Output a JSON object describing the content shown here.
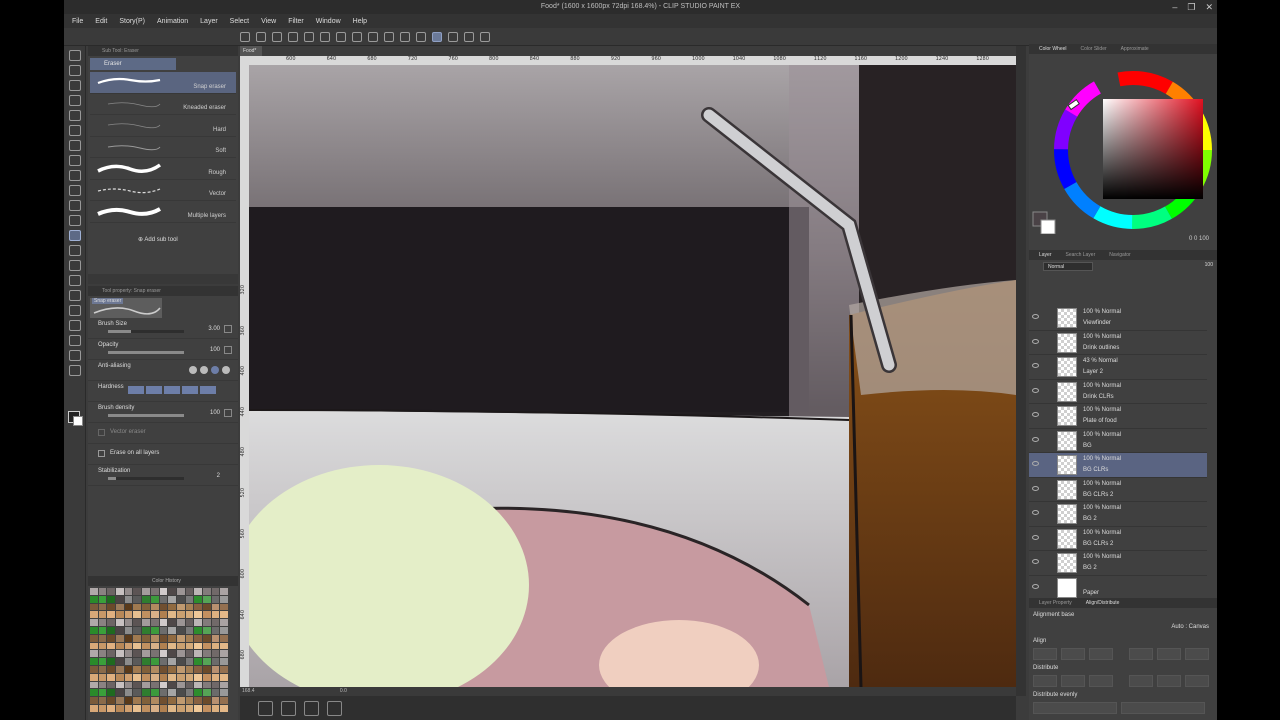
{
  "window": {
    "title": "Food* (1600 x 1600px 72dpi 168.4%)  - CLIP STUDIO PAINT EX",
    "controls": [
      "–",
      "❐",
      "✕"
    ]
  },
  "menu": [
    "File",
    "Edit",
    "Story(P)",
    "Animation",
    "Layer",
    "Select",
    "View",
    "Filter",
    "Window",
    "Help"
  ],
  "sub_tool_panel": {
    "header": "Sub Tool: Eraser",
    "group": "Eraser",
    "brushes": [
      {
        "name": "Snap eraser",
        "selected": true
      },
      {
        "name": "Kneaded eraser",
        "selected": false
      },
      {
        "name": "Hard",
        "selected": false
      },
      {
        "name": "Soft",
        "selected": false
      },
      {
        "name": "Rough",
        "selected": false
      },
      {
        "name": "Vector",
        "selected": false
      },
      {
        "name": "Multiple layers",
        "selected": false
      }
    ],
    "add_label": "Add sub tool"
  },
  "tool_property": {
    "header": "Tool property: Snap eraser",
    "preview_label": "Snap eraser",
    "brush_size": {
      "label": "Brush Size",
      "value": "3.00",
      "fraction": 0.3
    },
    "opacity": {
      "label": "Opacity",
      "value": "100",
      "fraction": 1.0
    },
    "anti_aliasing": {
      "label": "Anti-aliasing"
    },
    "hardness": {
      "label": "Hardness"
    },
    "brush_density": {
      "label": "Brush density",
      "value": "100",
      "fraction": 1.0
    },
    "vector_eraser": {
      "label": "Vector eraser"
    },
    "erase_all_layers": {
      "label": "Erase on all layers"
    },
    "stabilization": {
      "label": "Stabilization",
      "value": "2",
      "fraction": 0.1
    }
  },
  "color_history": {
    "header": "Color History"
  },
  "canvas": {
    "tab": "Food*",
    "zoom": "168.4",
    "angle": "0.0",
    "ruler_top": [
      "600",
      "640",
      "680",
      "720",
      "760",
      "800",
      "840",
      "880",
      "920",
      "960",
      "1000",
      "1040",
      "1080",
      "1120",
      "1160",
      "1200",
      "1240",
      "1280"
    ],
    "ruler_left": [
      "320",
      "360",
      "400",
      "440",
      "480",
      "520",
      "560",
      "600",
      "640",
      "680"
    ]
  },
  "right_panels": {
    "color_tabs": [
      "Color Wheel",
      "Color Slider",
      "Approximate"
    ],
    "color_values": "0  0  100",
    "layer_tabs": [
      "Layer",
      "Search Layer",
      "Navigator"
    ],
    "blend_mode": "Normal",
    "opacity": "100",
    "layers": [
      {
        "mode": "100 % Normal",
        "name": "Viewfinder",
        "type": "mask"
      },
      {
        "mode": "100 % Normal",
        "name": "Drink outlines",
        "type": "trans"
      },
      {
        "mode": "43 % Normal",
        "name": "Layer 2",
        "type": "trans"
      },
      {
        "mode": "100 % Normal",
        "name": "Drink CLRs",
        "type": "trans"
      },
      {
        "mode": "100 % Normal",
        "name": "Plate of food",
        "type": "folder"
      },
      {
        "mode": "100 % Normal",
        "name": "BG",
        "type": "trans"
      },
      {
        "mode": "100 % Normal",
        "name": "BG CLRs",
        "type": "trans",
        "selected": true
      },
      {
        "mode": "100 % Normal",
        "name": "BG CLRs 2",
        "type": "trans"
      },
      {
        "mode": "100 % Normal",
        "name": "BG 2",
        "type": "trans"
      },
      {
        "mode": "100 % Normal",
        "name": "BG CLRs 2",
        "type": "trans"
      },
      {
        "mode": "100 % Normal",
        "name": "BG 2",
        "type": "trans"
      },
      {
        "mode": "",
        "name": "Paper",
        "type": "white"
      }
    ],
    "align_tabs": [
      "Layer Property",
      "Align/Distribute"
    ],
    "alignment_base": "Alignment base",
    "auto_canvas": "Auto : Canvas",
    "align": "Align",
    "distribute": "Distribute",
    "distribute_evenly": "Distribute evenly"
  },
  "colors": {
    "accent": "#5d6a86",
    "panel": "#404040",
    "background": "#1e1b1e"
  }
}
